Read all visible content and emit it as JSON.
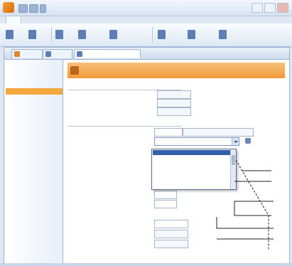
{
  "window": {
    "title": "",
    "menu_tab": ""
  },
  "ribbon": {
    "buttons": [
      {
        "icon": "new-icon",
        "label": ""
      },
      {
        "icon": "open-icon",
        "label": ""
      },
      {
        "icon": "save-icon",
        "label": ""
      },
      {
        "icon": "print-icon",
        "label": ""
      },
      {
        "icon": "calculate-icon",
        "label": ""
      },
      {
        "icon": "export-icon",
        "label": ""
      },
      {
        "icon": "report-icon",
        "label": ""
      },
      {
        "icon": "help-icon",
        "label": ""
      }
    ]
  },
  "doc_tabs": [
    {
      "label": ""
    },
    {
      "label": ""
    },
    {
      "label": ""
    }
  ],
  "sidebar": {
    "items": [
      {
        "label": ""
      },
      {
        "label": ""
      },
      {
        "label": ""
      },
      {
        "label": ""
      },
      {
        "label": "",
        "active": true
      },
      {
        "label": ""
      }
    ]
  },
  "header": {
    "title": ""
  },
  "watermark": "",
  "form": {
    "section_1_title": "",
    "section_2_title": "",
    "rows": [
      {
        "label": "",
        "value": ""
      },
      {
        "label": "",
        "value": ""
      },
      {
        "label": "",
        "value": ""
      },
      {
        "label": "",
        "value": ""
      },
      {
        "label": "",
        "value": ""
      },
      {
        "label": "",
        "value": ""
      },
      {
        "label": "",
        "value": ""
      },
      {
        "label": "",
        "value": ""
      },
      {
        "label": "",
        "value": ""
      },
      {
        "label": "",
        "value": ""
      },
      {
        "label": "",
        "value": ""
      },
      {
        "label": "",
        "value": ""
      },
      {
        "label": "",
        "value": ""
      },
      {
        "label": "",
        "value": ""
      },
      {
        "label": "",
        "value": ""
      }
    ],
    "extra_value": "",
    "dropdown": {
      "selected": "",
      "options": [
        "",
        "",
        "",
        "",
        "",
        "",
        ""
      ]
    }
  },
  "sketch": {
    "label_1": "",
    "label_2": ""
  },
  "colors": {
    "accent": "#f09a37",
    "selection": "#335ea8"
  }
}
